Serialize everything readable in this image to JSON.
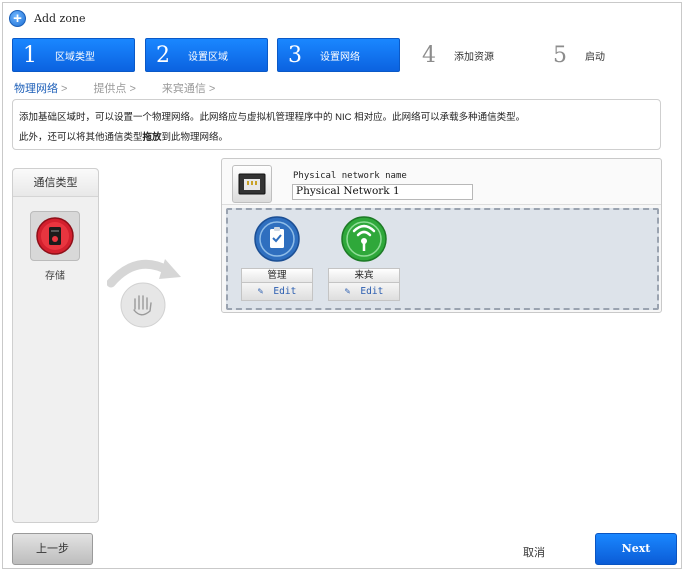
{
  "window": {
    "title": "Add zone"
  },
  "steps": [
    {
      "num": "1",
      "label": "区域类型",
      "state": "done"
    },
    {
      "num": "2",
      "label": "设置区域",
      "state": "done"
    },
    {
      "num": "3",
      "label": "设置网络",
      "state": "current"
    },
    {
      "num": "4",
      "label": "添加资源",
      "state": "todo"
    },
    {
      "num": "5",
      "label": "启动",
      "state": "todo"
    }
  ],
  "breadcrumb": [
    {
      "label": "物理网络",
      "arrow": ">"
    },
    {
      "label": "提供点",
      "arrow": ">"
    },
    {
      "label": "来宾通信",
      "arrow": ">"
    }
  ],
  "info": {
    "line1": "添加基础区域时，可以设置一个物理网络。此网络应与虚拟机管理程序中的 NIC 相对应。此网络可以承载多种通信类型。",
    "line2_prefix": "此外，还可以将其他通信类型",
    "line2_bold": "拖放",
    "line2_suffix": "到此物理网络。"
  },
  "traffic_types_panel": {
    "heading": "通信类型",
    "items": [
      {
        "label": "存储",
        "icon": "storage-icon"
      }
    ]
  },
  "physical_network": {
    "name_label": "Physical network name",
    "name_value": "Physical Network 1",
    "traffic": [
      {
        "label": "管理",
        "icon": "management-icon",
        "edit_label": "Edit",
        "color": "#2f6fbf"
      },
      {
        "label": "来宾",
        "icon": "guest-icon",
        "edit_label": "Edit",
        "color": "#2fa83a"
      }
    ]
  },
  "buttons": {
    "prev": "上一步",
    "cancel": "取消",
    "next": "Next"
  },
  "colors": {
    "accent": "#0b62e0",
    "storage": "#d3202e"
  }
}
